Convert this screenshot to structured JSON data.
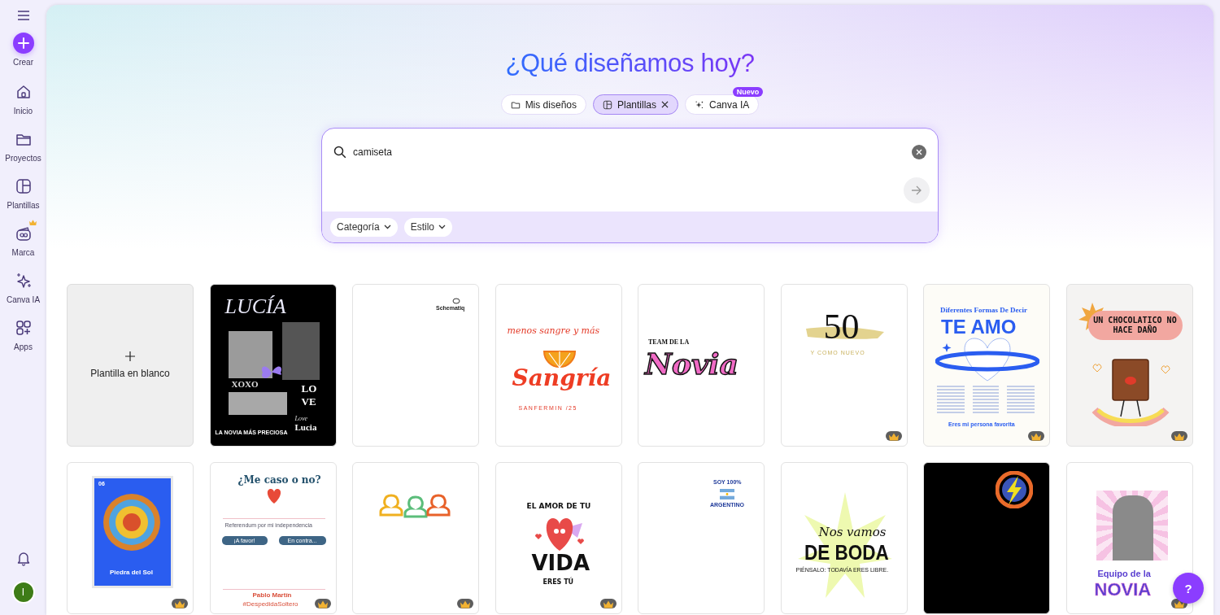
{
  "sidebar": {
    "create": {
      "label": "Crear"
    },
    "items": [
      {
        "label": "Inicio",
        "premium": false
      },
      {
        "label": "Proyectos",
        "premium": false
      },
      {
        "label": "Plantillas",
        "premium": false
      },
      {
        "label": "Marca",
        "premium": true
      },
      {
        "label": "Canva IA",
        "premium": false
      },
      {
        "label": "Apps",
        "premium": false
      }
    ],
    "avatar": "I"
  },
  "header": {
    "title": "¿Qué diseñamos hoy?",
    "chips": [
      {
        "label": "Mis diseños",
        "selected": false
      },
      {
        "label": "Plantillas",
        "selected": true
      },
      {
        "label": "Canva IA",
        "selected": false,
        "badge": "Nuevo"
      }
    ]
  },
  "search": {
    "value": "camiseta",
    "filters": [
      "Categoría",
      "Estilo"
    ]
  },
  "blank_template": {
    "label": "Plantilla en blanco"
  },
  "templates": [
    {
      "kind": "collage",
      "premium": false,
      "texts": [
        "LUCÍA",
        "LOVE",
        "XOXO",
        "LA NOVIA MÁS PRECIOSA",
        "Love",
        "Lucia"
      ]
    },
    {
      "kind": "corner-logo",
      "premium": false,
      "texts": [
        "Schematiq"
      ]
    },
    {
      "kind": "orange",
      "premium": false,
      "texts": [
        "menos sangre y más",
        "Sangría",
        "SANFERMIN /25"
      ]
    },
    {
      "kind": "team",
      "premium": false,
      "texts": [
        "TEAM DE LA",
        "Novia"
      ]
    },
    {
      "kind": "brush",
      "premium": true,
      "texts": [
        "50",
        "Y COMO NUEVO"
      ]
    },
    {
      "kind": "heart-ring",
      "premium": true,
      "texts": [
        "Diferentes Formas De Decir",
        "TE AMO",
        "Eres mi persona favorita"
      ]
    },
    {
      "kind": "chocolate",
      "premium": true,
      "texts": [
        "UN CHOCOLATICO NO HACE DAÑO"
      ]
    },
    {
      "kind": "stone",
      "premium": true,
      "texts": [
        "06",
        "Piedra del Sol"
      ]
    },
    {
      "kind": "referendum",
      "premium": true,
      "texts": [
        "¿Me caso o no?",
        "Referendum por mi independencia",
        "¡A favor!",
        "En contra...",
        "Pablo Martín",
        "#DespedidaSoltero"
      ]
    },
    {
      "kind": "people",
      "premium": true
    },
    {
      "kind": "heart-life",
      "premium": true,
      "texts": [
        "EL AMOR DE TU",
        "VIDA",
        "ERES TÚ"
      ]
    },
    {
      "kind": "flag",
      "premium": false,
      "texts": [
        "SOY 100%",
        "ARGENTINO"
      ]
    },
    {
      "kind": "burst",
      "premium": false,
      "texts": [
        "Nos vamos",
        "DE BODA",
        "PIÉNSALO: TODAVÍA ERES LIBRE."
      ]
    },
    {
      "kind": "emblem",
      "premium": false
    },
    {
      "kind": "pop-photo",
      "premium": true,
      "texts": [
        "Equipo de la",
        "NOVIA"
      ]
    }
  ],
  "help": {
    "label": "?"
  }
}
